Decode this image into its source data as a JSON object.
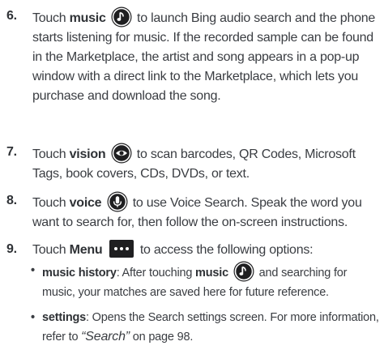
{
  "steps": [
    {
      "number": "6.",
      "lead": "Touch ",
      "keyword": "music",
      "icon": "music-note-icon",
      "text": " to launch Bing audio search and the phone starts listening for music. If the recorded sample can be found in the Marketplace, the artist and song appears in a pop-up window with a direct link to the Marketplace, which lets you purchase and download the song."
    },
    {
      "number": "7.",
      "lead": "Touch ",
      "keyword": "vision",
      "icon": "eye-icon",
      "text": " to scan barcodes, QR Codes, Microsoft Tags, book covers, CDs, DVDs, or text."
    },
    {
      "number": "8.",
      "lead": "Touch ",
      "keyword": "voice",
      "icon": "microphone-icon",
      "text": " to use Voice Search. Speak the word you want to search for, then follow the on-screen instructions."
    },
    {
      "number": "9.",
      "lead": "Touch ",
      "keyword": "Menu",
      "icon": "more-dots-icon",
      "text": " to access the following options:"
    }
  ],
  "sub_items": [
    {
      "bullet": "•",
      "keyword": "music history",
      "text_1": ": After touching ",
      "keyword_2": "music",
      "icon": "music-note-icon",
      "text_2": " and searching for music, your matches are saved here for future reference."
    },
    {
      "bullet": "•",
      "keyword": "settings",
      "text_1": ": Opens the Search settings screen. For more information, refer to ",
      "ref": "“Search”",
      "text_2": " on page 98."
    }
  ],
  "colors": {
    "text": "#3a3d42",
    "icon_bg": "#1f1f21",
    "icon_fg": "#ffffff"
  }
}
